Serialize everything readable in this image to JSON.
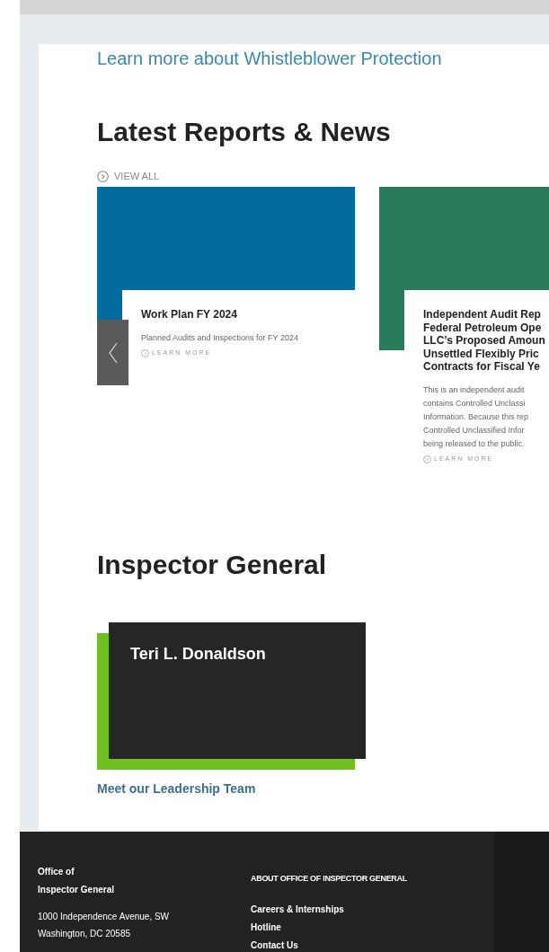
{
  "whistleblower_link": "Learn more about Whistleblower Protection",
  "reports": {
    "heading": "Latest Reports & News",
    "view_all": "VIEW ALL",
    "cards": [
      {
        "color": "#046b9f",
        "title_lines": [
          "Work Plan FY 2024"
        ],
        "description_lines": [
          "Planned Audits and Inspections for FY 2024"
        ],
        "link": "LEARN MORE"
      },
      {
        "color": "#2a7a5c",
        "title_lines": [
          "Independent Audit Rep",
          "Federal Petroleum Ope",
          "LLC’s Proposed Amoun",
          "Unsettled Flexibly Pric",
          "Contracts for Fiscal Ye"
        ],
        "description_lines": [
          "This is an independent audit",
          "contains Controlled Unclassi",
          "Information. Because this rep",
          "Controlled Unclassified Infor",
          "being released to the public."
        ],
        "link": "LEARN MORE"
      }
    ]
  },
  "inspector_general": {
    "heading": "Inspector General",
    "name": "Teri L. Donaldson",
    "link": "Meet our Leadership Team"
  },
  "footer": {
    "org_lines": [
      "Office of",
      "Inspector General"
    ],
    "address_lines": [
      "1000 Independence Avenue, SW",
      "Washington, DC 20585"
    ],
    "column_heading": "ABOUT OFFICE OF INSPECTOR GENERAL",
    "links": [
      "Careers & Internships",
      "Hotline",
      "Contact Us"
    ]
  }
}
